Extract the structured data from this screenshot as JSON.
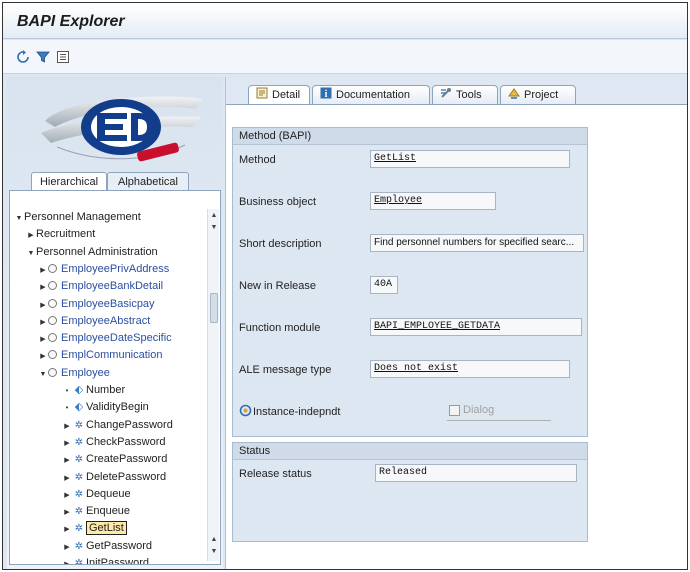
{
  "window": {
    "title": "BAPI Explorer"
  },
  "toolbar": {
    "icons": [
      "refresh-icon",
      "filter-icon",
      "list-icon"
    ]
  },
  "left": {
    "tabs": [
      "Hierarchical",
      "Alphabetical"
    ],
    "tree": [
      {
        "label": "Personnel Management",
        "kind": "folder",
        "expanded": true,
        "level": 0
      },
      {
        "label": "Recruitment",
        "kind": "folder",
        "expanded": false,
        "level": 1
      },
      {
        "label": "Personnel Administration",
        "kind": "folder",
        "expanded": true,
        "level": 1
      },
      {
        "label": "EmployeePrivAddress",
        "kind": "object",
        "expanded": false,
        "level": 2
      },
      {
        "label": "EmployeeBankDetail",
        "kind": "object",
        "expanded": false,
        "level": 2
      },
      {
        "label": "EmployeeBasicpay",
        "kind": "object",
        "expanded": false,
        "level": 2
      },
      {
        "label": "EmployeeAbstract",
        "kind": "object",
        "expanded": false,
        "level": 2
      },
      {
        "label": "EmployeeDateSpecific",
        "kind": "object",
        "expanded": false,
        "level": 2
      },
      {
        "label": "EmplCommunication",
        "kind": "object",
        "expanded": false,
        "level": 2
      },
      {
        "label": "Employee",
        "kind": "object",
        "expanded": true,
        "level": 2
      },
      {
        "label": "Number",
        "kind": "key",
        "level": 3
      },
      {
        "label": "ValidityBegin",
        "kind": "key",
        "level": 3
      },
      {
        "label": "ChangePassword",
        "kind": "method",
        "level": 3
      },
      {
        "label": "CheckPassword",
        "kind": "method",
        "level": 3
      },
      {
        "label": "CreatePassword",
        "kind": "method",
        "level": 3
      },
      {
        "label": "DeletePassword",
        "kind": "method",
        "level": 3
      },
      {
        "label": "Dequeue",
        "kind": "method",
        "level": 3
      },
      {
        "label": "Enqueue",
        "kind": "method",
        "level": 3
      },
      {
        "label": "GetList",
        "kind": "method",
        "level": 3,
        "selected": true
      },
      {
        "label": "GetPassword",
        "kind": "method",
        "level": 3
      },
      {
        "label": "InitPassword",
        "kind": "method",
        "level": 3
      }
    ]
  },
  "tabs": [
    {
      "label": "Detail",
      "icon": "detail-icon",
      "active": true
    },
    {
      "label": "Documentation",
      "icon": "info-icon",
      "active": false
    },
    {
      "label": "Tools",
      "icon": "tools-icon",
      "active": false
    },
    {
      "label": "Project",
      "icon": "project-icon",
      "active": false
    }
  ],
  "method_group": {
    "title": "Method (BAPI)",
    "method_label": "Method",
    "method_value": "GetList",
    "business_object_label": "Business object",
    "business_object_value": "Employee",
    "short_description_label": "Short description",
    "short_description_value": "Find personnel numbers for specified searc...",
    "release_label": "New in Release",
    "release_value": "40A",
    "function_module_label": "Function module",
    "function_module_value": "BAPI_EMPLOYEE_GETDATA",
    "ale_label": "ALE message type",
    "ale_value": "Does not exist",
    "instance_label": "Instance-indepndt",
    "dialog_label": "Dialog"
  },
  "status_group": {
    "title": "Status",
    "release_status_label": "Release status",
    "release_status_value": "Released"
  },
  "colors": {
    "accent": "#2f6fb1",
    "tree_link": "#2a4fa0",
    "selection": "#ffe9a8"
  }
}
